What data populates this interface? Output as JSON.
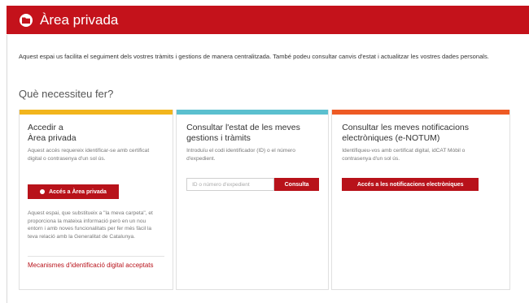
{
  "header": {
    "title": "Àrea privada"
  },
  "intro": "Aquest espai us facilita el seguiment dels vostres tràmits i gestions de manera centralitzada. També podeu consultar canvis d'estat i actualitzar les vostres dades personals.",
  "section_title": "Què necessiteu fer?",
  "cards": [
    {
      "accent": "#f2b51d",
      "title_line1": "Accedir a",
      "title_line2": "Àrea privada",
      "description": "Aquest accés requereix identificar-se amb certificat digital o contrasenya d'un sol ús.",
      "button_label": "Accés a Àrea privada",
      "note": "Aquest espai, que substitueix a \"la meva carpeta\", et proporciona la mateixa informació però en un nou entorn i amb noves funcionalitats per fer més fàcil la teva relació amb la Generalitat de Catalunya.",
      "link": "Mecanismes d'identificació digital acceptats"
    },
    {
      "accent": "#5bc0cf",
      "title": "Consultar l'estat de les meves gestions i tràmits",
      "description": "Introduïu el codi identificador (ID) o el número d'expedient.",
      "input_placeholder": "ID o número d'expedient",
      "button_label": "Consulta"
    },
    {
      "accent": "#ee5a24",
      "title": "Consultar les meves notificacions electròniques (e-NOTUM)",
      "description": "Identifiqueu-vos amb certificat digital, idCAT Mòbil o contrasenya d'un sol ús.",
      "button_label": "Accés a les notificacions electròniques"
    }
  ]
}
